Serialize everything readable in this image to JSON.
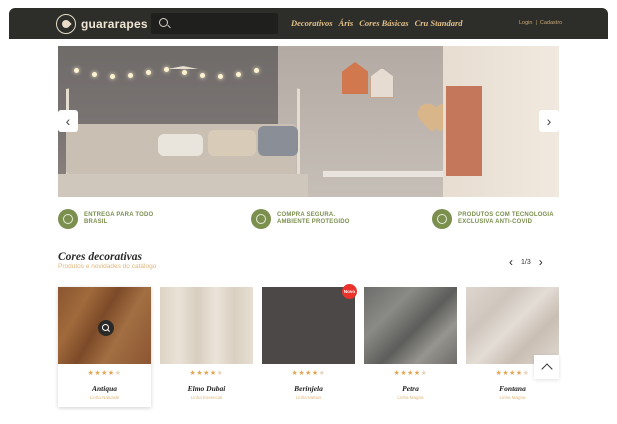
{
  "header": {
    "logo_text": "guararapes",
    "search_placeholder": "",
    "nav": [
      "Decorativos",
      "Áris",
      "Cores Básicas",
      "Cru Standard"
    ],
    "login": "Login",
    "separator": "|",
    "register": "Cadastro"
  },
  "banner": {
    "prev_icon": "chevron-left-icon",
    "next_icon": "chevron-right-icon"
  },
  "features": [
    {
      "icon": "leaf-icon",
      "line1": "ENTREGA PARA TODO",
      "line2": "BRASIL"
    },
    {
      "icon": "shield-check-icon",
      "line1": "COMPRA SEGURA.",
      "line2": "AMBIENTE PROTEGIDO"
    },
    {
      "icon": "leaf-icon",
      "line1": "PRODUTOS COM TECNOLOGIA",
      "line2": "EXCLUSIVA ANTI-COVID"
    }
  ],
  "section": {
    "title": "Cores decorativas",
    "subtitle": "Produtos e novidades do catálogo",
    "page": "1/3"
  },
  "products": [
    {
      "name": "Antiqua",
      "line": "Linha Naturale",
      "rating": 4,
      "max": 5
    },
    {
      "name": "Elmo Dubai",
      "line": "Linha Essencial",
      "rating": 4,
      "max": 5
    },
    {
      "name": "Berinjela",
      "line": "Linha Metais",
      "rating": 4,
      "max": 5,
      "badge": "Novo"
    },
    {
      "name": "Petra",
      "line": "Linha Magna",
      "rating": 4,
      "max": 5
    },
    {
      "name": "Fontana",
      "line": "Linha Magna",
      "rating": 4,
      "max": 5
    }
  ],
  "colors": {
    "header_bg": "#2d2d2a",
    "nav_accent": "#e3c18a",
    "feature_green": "#7b8f4f",
    "star": "#e3a654",
    "badge_red": "#e8322a"
  }
}
